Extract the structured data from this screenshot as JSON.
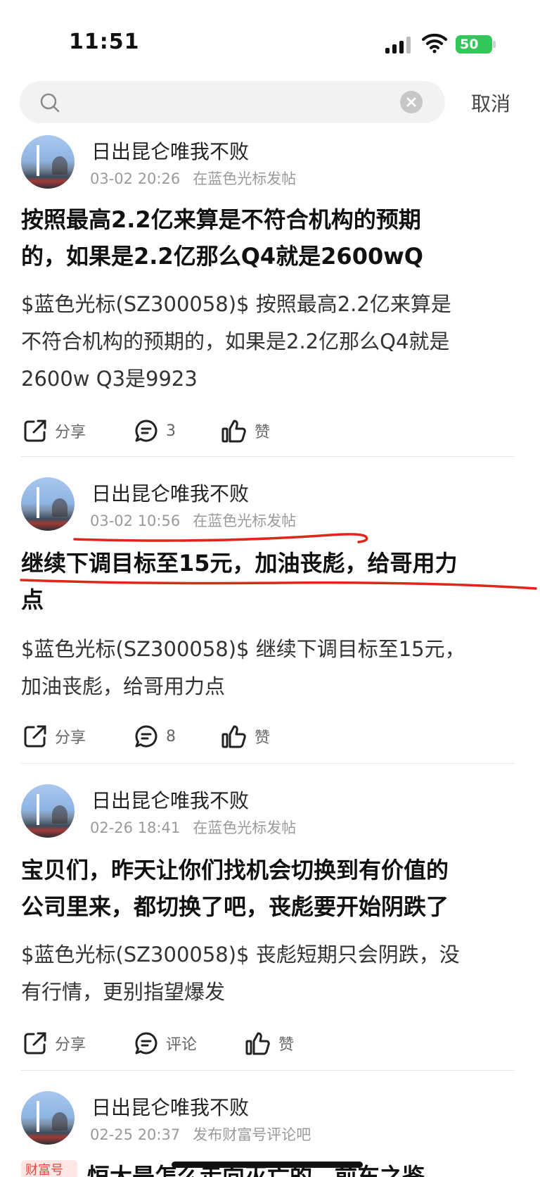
{
  "status": {
    "time": "11:51",
    "battery": "50"
  },
  "search": {
    "value": "",
    "placeholder": "",
    "cancel_label": "取消"
  },
  "posts": [
    {
      "author": "日出昆仑唯我不败",
      "date": "03-02 20:26",
      "source": "在蓝色光标发帖",
      "title_lines": [
        "按照最高2.2亿来算是不符合机构的预期",
        "的，如果是2.2亿那么Q4就是2600wQ"
      ],
      "body_lines": [
        "$蓝色光标(SZ300058)$ 按照最高2.2亿来算是",
        "不符合机构的预期的，如果是2.2亿那么Q4就是",
        "2600w Q3是9923"
      ],
      "share_label": "分享",
      "comment_label": "3",
      "like_label": "赞"
    },
    {
      "author": "日出昆仑唯我不败",
      "date": "03-02 10:56",
      "source": "在蓝色光标发帖",
      "title_lines": [
        "继续下调目标至15元，加油丧彪，给哥用力",
        "点"
      ],
      "body_lines": [
        "$蓝色光标(SZ300058)$ 继续下调目标至15元，",
        "加油丧彪，给哥用力点"
      ],
      "share_label": "分享",
      "comment_label": "8",
      "like_label": "赞"
    },
    {
      "author": "日出昆仑唯我不败",
      "date": "02-26 18:41",
      "source": "在蓝色光标发帖",
      "title_lines": [
        "宝贝们，昨天让你们找机会切换到有价值的",
        "公司里来，都切换了吧，丧彪要开始阴跌了"
      ],
      "body_lines": [
        "$蓝色光标(SZ300058)$ 丧彪短期只会阴跌，没",
        "有行情，更别指望爆发"
      ],
      "share_label": "分享",
      "comment_label": "评论",
      "like_label": "赞"
    },
    {
      "author": "日出昆仑唯我不败",
      "date": "02-25 20:37",
      "source": "发布财富号评论吧",
      "badge": "财富号",
      "title_partial": "恒大是怎么走向灭亡的，前车之鉴"
    }
  ],
  "colors": {
    "annotation": "#e0261b",
    "battery": "#33c759"
  }
}
